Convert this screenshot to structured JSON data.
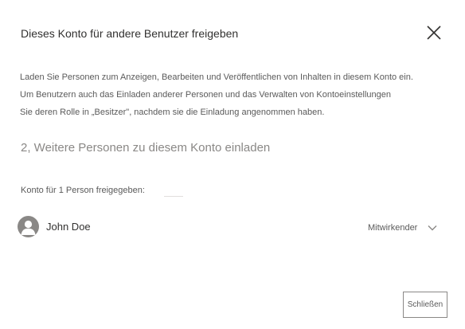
{
  "dialog": {
    "title": "Dieses Konto für andere Benutzer freigeben",
    "close_icon": "close-icon",
    "description": [
      "Laden Sie Personen zum Anzeigen, Bearbeiten und Veröffentlichen von Inhalten in diesem Konto ein.",
      "Um Benutzern auch das Einladen anderer Personen und das Verwalten von Kontoeinstellungen",
      "Sie deren Rolle in „Besitzer\", nachdem sie die Einladung angenommen haben."
    ],
    "invite_label": "2, Weitere Personen zu diesem Konto einladen",
    "shared_label": "Konto für 1 Person freigegeben:",
    "people": [
      {
        "name": "John Doe",
        "role": "Mitwirkender",
        "avatar_icon": "person-icon",
        "role_icon": "chevron-down-icon"
      }
    ],
    "close_button": "Schließen"
  },
  "colors": {
    "title": "#323130",
    "muted": "#8a8886",
    "body_text": "#5a5a5a",
    "avatar": "#8a8886"
  }
}
